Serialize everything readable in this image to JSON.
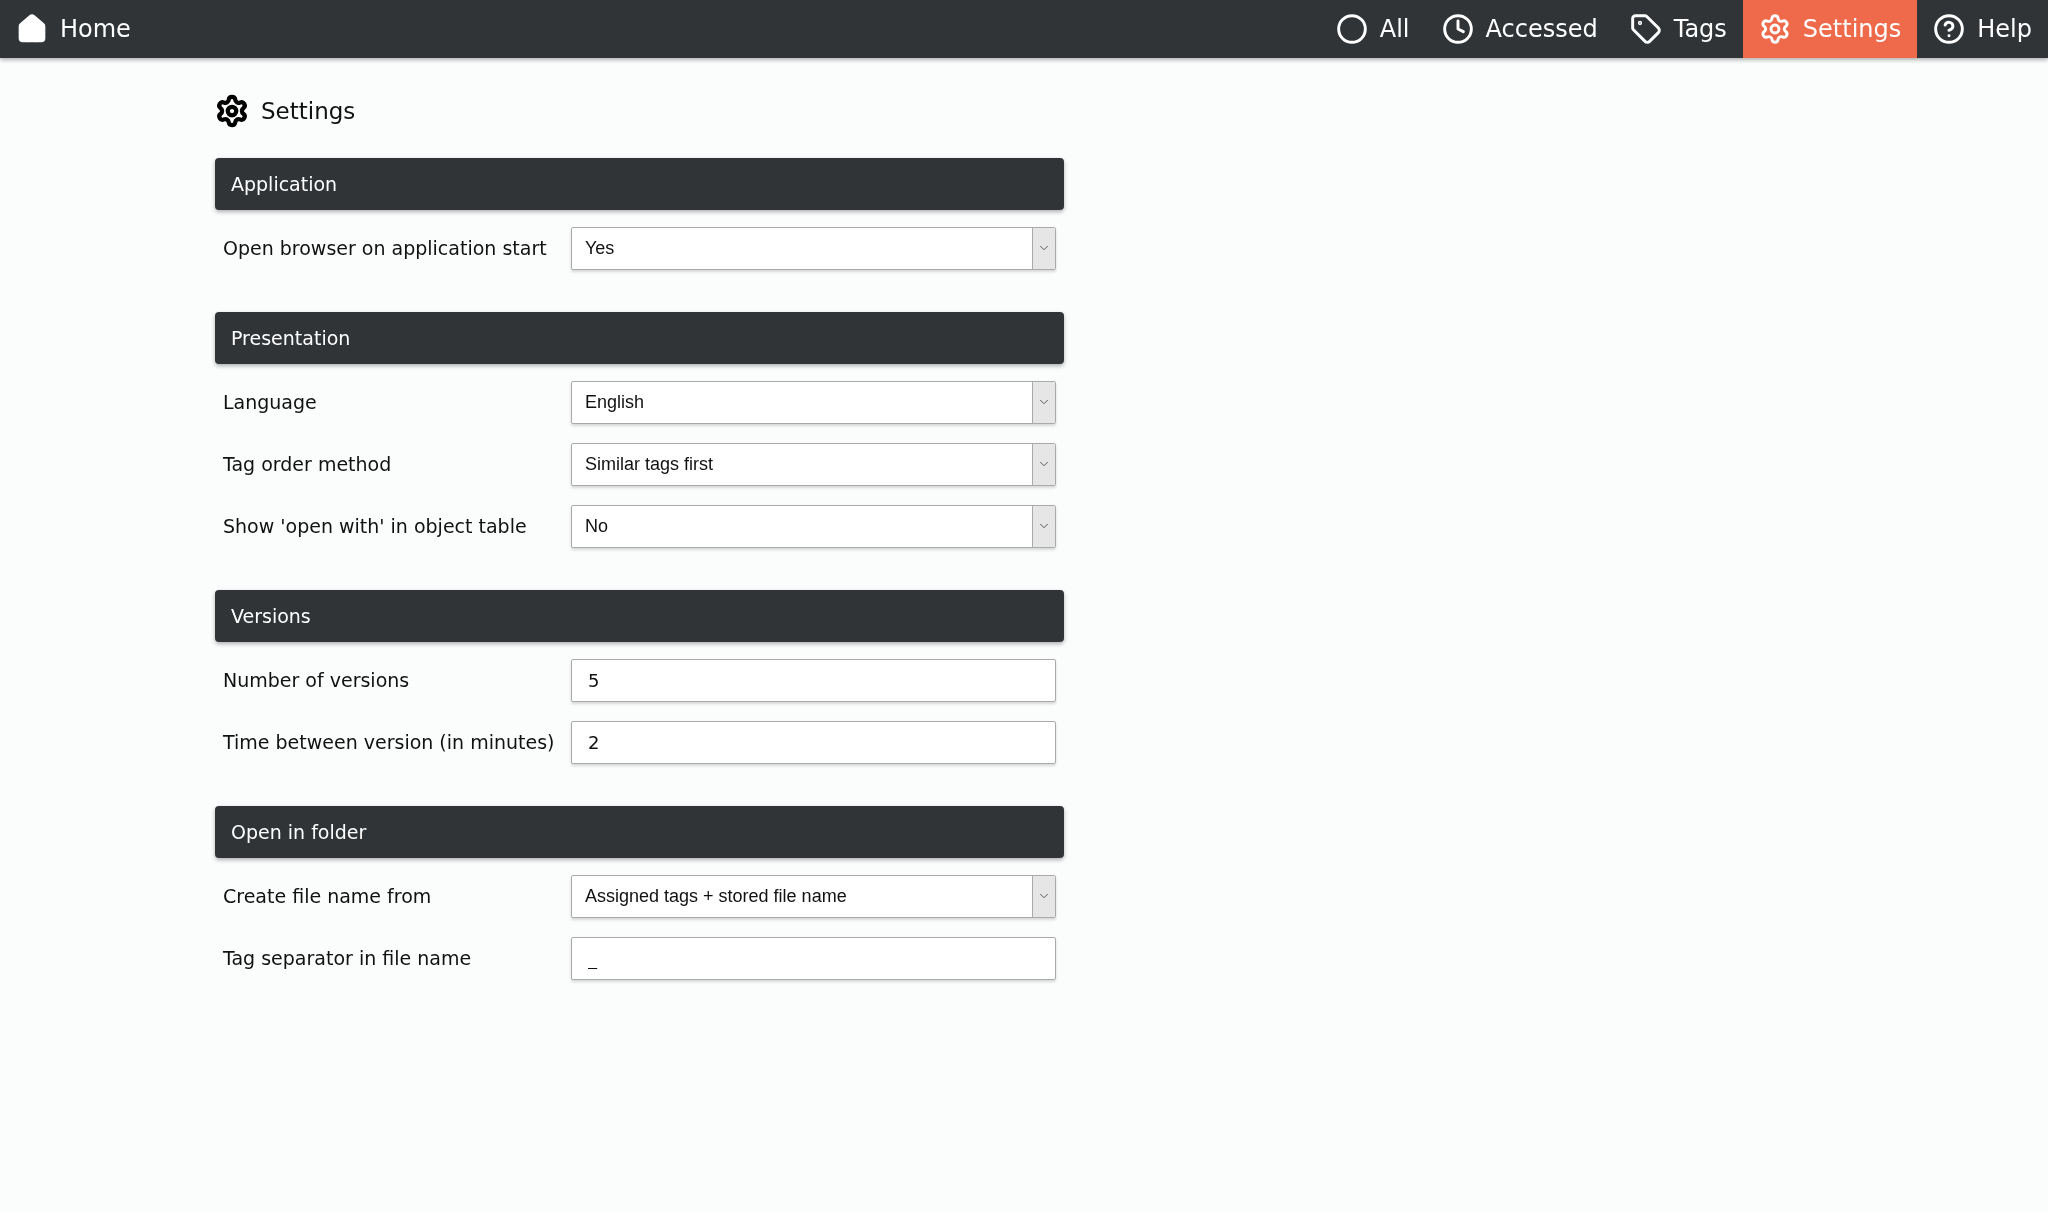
{
  "navbar": {
    "home": {
      "label": "Home"
    },
    "items": [
      {
        "label": "All",
        "kind": "circle",
        "selected": false
      },
      {
        "label": "Accessed",
        "kind": "clock",
        "selected": false
      },
      {
        "label": "Tags",
        "kind": "tag",
        "selected": false
      },
      {
        "label": "Settings",
        "kind": "gear",
        "selected": true
      },
      {
        "label": "Help",
        "kind": "help",
        "selected": false
      }
    ]
  },
  "page": {
    "title": "Settings"
  },
  "sections": [
    {
      "title": "Application",
      "fields": [
        {
          "label": "Open browser on application start",
          "kind": "select",
          "value": "Yes"
        }
      ]
    },
    {
      "title": "Presentation",
      "fields": [
        {
          "label": "Language",
          "kind": "select",
          "value": "English"
        },
        {
          "label": "Tag order method",
          "kind": "select",
          "value": "Similar tags first"
        },
        {
          "label": "Show 'open with' in object table",
          "kind": "select",
          "value": "No"
        }
      ]
    },
    {
      "title": "Versions",
      "fields": [
        {
          "label": "Number of versions",
          "kind": "text",
          "value": "5"
        },
        {
          "label": "Time between version (in minutes)",
          "kind": "text",
          "value": "2"
        }
      ]
    },
    {
      "title": "Open in folder",
      "fields": [
        {
          "label": "Create file name from",
          "kind": "select",
          "value": "Assigned tags + stored file name"
        },
        {
          "label": "Tag separator in file name",
          "kind": "text",
          "value": "_"
        }
      ]
    }
  ]
}
